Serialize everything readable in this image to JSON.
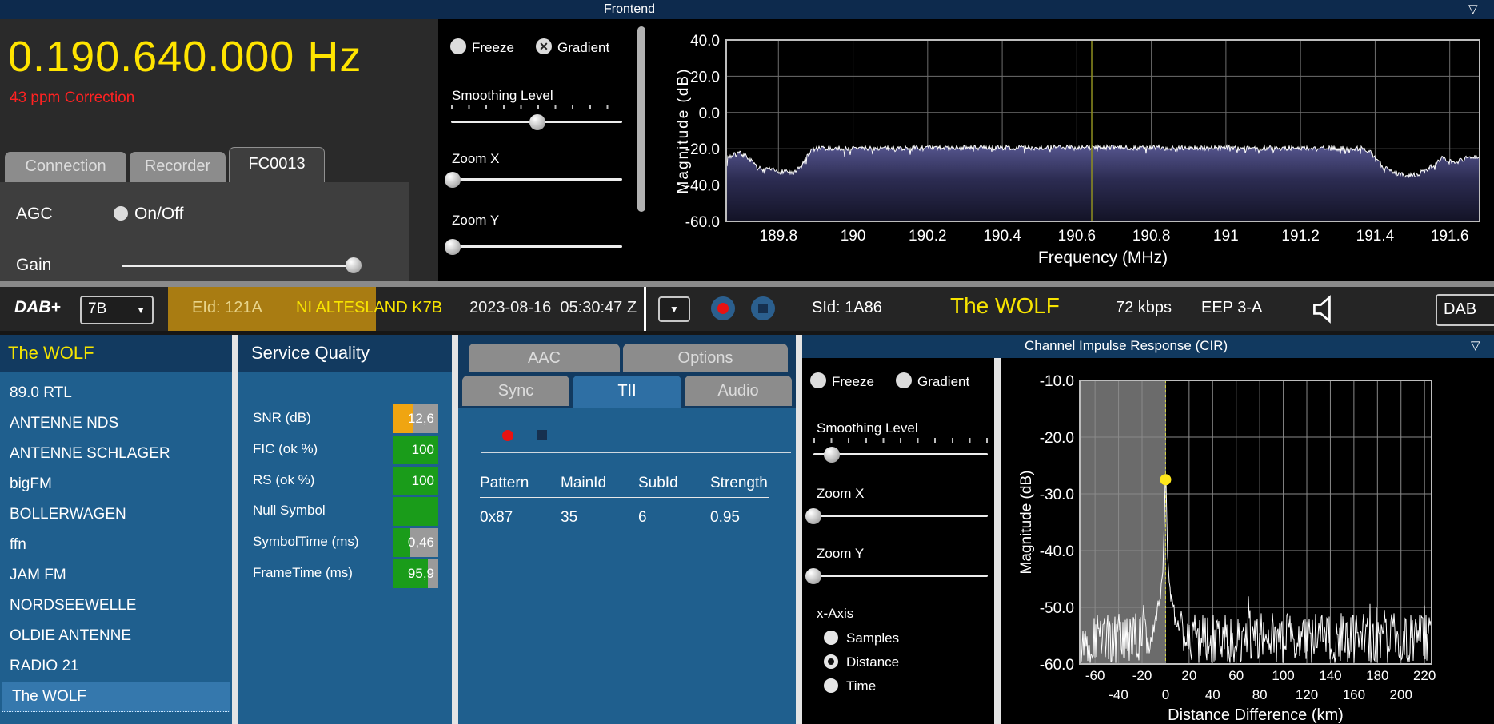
{
  "window": {
    "top_title": "Frontend",
    "collapse_icon": "▽"
  },
  "icons": {
    "dropdown_arrow": "▼",
    "collapse": "▽",
    "checked_x": "✕"
  },
  "colors": {
    "accent_yellow": "#f5e400",
    "warning_red": "#ff2222",
    "panel_blue": "#1f5f8e",
    "header_navy": "#123a60",
    "ensemble_olive": "#a97c12",
    "ok_green": "#1a9c1a",
    "snr_orange": "#f0a511",
    "record_red": "#e81212"
  },
  "tuner": {
    "frequency_display": "0.190.640.000 Hz",
    "correction": "43 ppm Correction",
    "tabs": [
      {
        "label": "Connection",
        "active": false
      },
      {
        "label": "Recorder",
        "active": false
      },
      {
        "label": "FC0013",
        "active": true
      }
    ],
    "agc_label": "AGC",
    "agc_toggle_label": "On/Off",
    "gain_label": "Gain"
  },
  "spectrum_controls": {
    "freeze_label": "Freeze",
    "freeze_checked": false,
    "gradient_label": "Gradient",
    "gradient_checked": true,
    "smoothing_label": "Smoothing Level",
    "zoom_x_label": "Zoom X",
    "zoom_y_label": "Zoom Y"
  },
  "dab_bar": {
    "mode": "DAB+",
    "channel": "7B",
    "eid": "EId: 121A",
    "ensemble": "NI ALTESLAND K7B",
    "datetime": "2023-08-16  05:30:47 Z",
    "sid": "SId: 1A86",
    "service": "The WOLF",
    "bitrate": "72 kbps",
    "protection": "EEP 3-A",
    "output_device": "DAB"
  },
  "stations": {
    "header": "The WOLF",
    "selected_index": 10,
    "items": [
      "89.0 RTL",
      "ANTENNE NDS",
      "ANTENNE SCHLAGER",
      "bigFM",
      "BOLLERWAGEN",
      "ffn",
      "JAM FM",
      "NORDSEEWELLE",
      "OLDIE ANTENNE",
      "RADIO 21",
      "The WOLF"
    ]
  },
  "service_quality": {
    "title": "Service Quality",
    "rows": [
      {
        "label": "SNR (dB)",
        "value": "12,6",
        "fill": 0.42,
        "color": "#f0a511"
      },
      {
        "label": "FIC (ok %)",
        "value": "100",
        "fill": 1.0,
        "color": "#1a9c1a"
      },
      {
        "label": "RS (ok %)",
        "value": "100",
        "fill": 1.0,
        "color": "#1a9c1a"
      },
      {
        "label": "Null Symbol",
        "value": "",
        "fill": 1.0,
        "color": "#1a9c1a"
      },
      {
        "label": "SymbolTime (ms)",
        "value": "0,46",
        "fill": 0.38,
        "color": "#1a9c1a"
      },
      {
        "label": "FrameTime (ms)",
        "value": "95,9",
        "fill": 0.76,
        "color": "#1a9c1a"
      }
    ]
  },
  "tii": {
    "tabs_row1": [
      {
        "label": "AAC",
        "active": false
      },
      {
        "label": "Options",
        "active": false
      }
    ],
    "tabs_row2": [
      {
        "label": "Sync",
        "active": false
      },
      {
        "label": "TII",
        "active": true
      },
      {
        "label": "Audio",
        "active": false
      }
    ],
    "table": {
      "headers": [
        "Pattern",
        "MainId",
        "SubId",
        "Strength"
      ],
      "rows": [
        [
          "0x87",
          "35",
          "6",
          "0.95"
        ]
      ]
    }
  },
  "cir": {
    "title": "Channel Impulse Response (CIR)",
    "collapse_icon": "▽"
  },
  "cir_controls": {
    "freeze_label": "Freeze",
    "freeze_checked": false,
    "gradient_label": "Gradient",
    "gradient_checked": false,
    "smoothing_label": "Smoothing Level",
    "zoom_x_label": "Zoom X",
    "zoom_y_label": "Zoom Y",
    "x_axis_label": "x-Axis",
    "options": [
      {
        "label": "Samples",
        "selected": false
      },
      {
        "label": "Distance",
        "selected": true
      },
      {
        "label": "Time",
        "selected": false
      }
    ]
  },
  "chart_data": [
    {
      "id": "frontend-spectrum",
      "type": "area",
      "title": "Frontend",
      "xlabel": "Frequency (MHz)",
      "ylabel": "Magnitude (dB)",
      "xlim": [
        189.66,
        191.68
      ],
      "ylim": [
        -60,
        40
      ],
      "xticks": [
        [
          189.8,
          "189.8"
        ],
        [
          190,
          "190"
        ],
        [
          190.2,
          "190.2"
        ],
        [
          190.4,
          "190.4"
        ],
        [
          190.6,
          "190.6"
        ],
        [
          190.8,
          "190.8"
        ],
        [
          191,
          "191"
        ],
        [
          191.2,
          "191.2"
        ],
        [
          191.4,
          "191.4"
        ],
        [
          191.6,
          "191.6"
        ]
      ],
      "yticks": [
        [
          40,
          "40.0"
        ],
        [
          20,
          "20.0"
        ],
        [
          0,
          "0.0"
        ],
        [
          -20,
          "-20.0"
        ],
        [
          -40,
          "-40.0"
        ],
        [
          -60,
          "-60.0"
        ]
      ],
      "cursor_x": 190.64,
      "grid": true,
      "noise_jitter_db": 1.4,
      "envelope": [
        [
          189.66,
          -25
        ],
        [
          189.68,
          -23.5
        ],
        [
          189.7,
          -22.5
        ],
        [
          189.72,
          -25
        ],
        [
          189.74,
          -30
        ],
        [
          189.76,
          -32
        ],
        [
          189.78,
          -31.5
        ],
        [
          189.8,
          -33
        ],
        [
          189.82,
          -32
        ],
        [
          189.84,
          -34
        ],
        [
          189.86,
          -30
        ],
        [
          189.875,
          -25
        ],
        [
          189.89,
          -20.5
        ],
        [
          189.91,
          -19.8
        ],
        [
          190.2,
          -19.6
        ],
        [
          190.64,
          -19.3
        ],
        [
          191.1,
          -19.6
        ],
        [
          191.37,
          -19.8
        ],
        [
          191.39,
          -22
        ],
        [
          191.41,
          -28
        ],
        [
          191.43,
          -31
        ],
        [
          191.46,
          -33.5
        ],
        [
          191.49,
          -35
        ],
        [
          191.52,
          -33.5
        ],
        [
          191.54,
          -31.5
        ],
        [
          191.56,
          -28
        ],
        [
          191.58,
          -24.5
        ],
        [
          191.6,
          -26.5
        ],
        [
          191.62,
          -27
        ],
        [
          191.64,
          -25.5
        ],
        [
          191.66,
          -24
        ],
        [
          191.68,
          -25
        ]
      ]
    },
    {
      "id": "cir",
      "type": "line",
      "title": "Channel Impulse Response (CIR)",
      "xlabel": "Distance Difference (km)",
      "ylabel": "Magnitude (dB)",
      "xlim": [
        -73,
        226
      ],
      "ylim": [
        -60,
        -10
      ],
      "xticks": [
        [
          -60,
          "-60"
        ],
        [
          -40,
          "-40"
        ],
        [
          -20,
          "-20"
        ],
        [
          0,
          "0"
        ],
        [
          20,
          "20"
        ],
        [
          40,
          "40"
        ],
        [
          60,
          "60"
        ],
        [
          80,
          "80"
        ],
        [
          100,
          "100"
        ],
        [
          120,
          "120"
        ],
        [
          140,
          "140"
        ],
        [
          160,
          "160"
        ],
        [
          180,
          "180"
        ],
        [
          200,
          "200"
        ],
        [
          220,
          "220"
        ]
      ],
      "yticks": [
        [
          -10,
          "-10.0"
        ],
        [
          -20,
          "-20.0"
        ],
        [
          -30,
          "-30.0"
        ],
        [
          -40,
          "-40.0"
        ],
        [
          -50,
          "-50.0"
        ],
        [
          -60,
          "-60.0"
        ]
      ],
      "grid": true,
      "shaded_region_x": [
        -73,
        0
      ],
      "peak": {
        "x": 0,
        "y": -27.5
      },
      "noise_floor_db": [
        -60,
        -50
      ]
    }
  ]
}
